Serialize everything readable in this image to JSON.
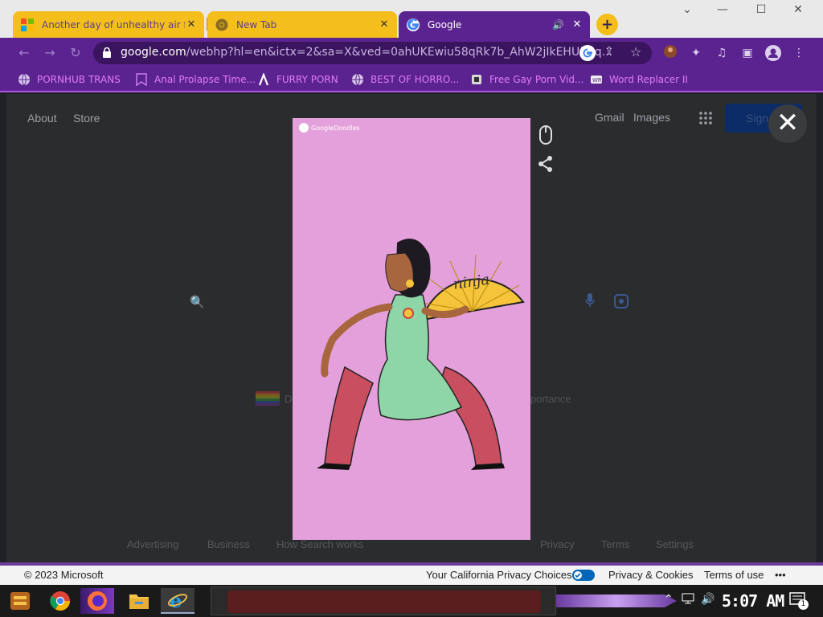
{
  "tabs": [
    {
      "title": "Another day of unhealthy air f",
      "close": "✕"
    },
    {
      "title": "New Tab",
      "close": "✕"
    },
    {
      "title": "Google",
      "close": "✕",
      "audio": "🔊"
    }
  ],
  "window_controls": {
    "minimize": "—",
    "maximize": "☐",
    "close": "✕",
    "dropdown": "⌄",
    "new_tab": "+"
  },
  "toolbar": {
    "url_main": "google.com",
    "url_rest": "/webhp?hl=en&ictx=2&sa=X&ved=0ahUKEwiu58qRk7b_AhW2jIkEHUfiCq..."
  },
  "bookmarks": [
    {
      "label": "PORNHUB TRANS",
      "icon": "globe-icon"
    },
    {
      "label": "Anal Prolapse Time...",
      "icon": "bookmark-icon"
    },
    {
      "label": "FURRY PORN",
      "icon": "lambda-icon"
    },
    {
      "label": "BEST OF HORRO...",
      "icon": "globe-icon"
    },
    {
      "label": "Free Gay Porn Vid...",
      "icon": "site-icon"
    },
    {
      "label": "Word Replacer II",
      "icon": "extension-icon"
    }
  ],
  "google": {
    "about": "About",
    "store": "Store",
    "gmail": "Gmail",
    "images": "Images",
    "sign_in": "Sign in",
    "doodle_caption_left": "D",
    "doodle_caption_right": "portance",
    "footer": [
      "Advertising",
      "Business",
      "How Search works",
      "Privacy",
      "Terms",
      "Settings"
    ]
  },
  "doodle": {
    "logo_text": "GoogleDoodles",
    "fan_text": "ninja"
  },
  "ms_bar": {
    "copyright": "© 2023 Microsoft",
    "privacy_choices": "Your California Privacy Choices",
    "privacy_cookies": "Privacy & Cookies",
    "terms": "Terms of use",
    "more": "•••"
  },
  "taskbar": {
    "clock": "5:07 AM",
    "notifications": "1"
  },
  "colors": {
    "tab_yellow": "#f4bf1c",
    "chrome_purple": "#5b2390",
    "doodle_bg": "#e4a0da",
    "bookmark_text": "#e17bf5"
  }
}
